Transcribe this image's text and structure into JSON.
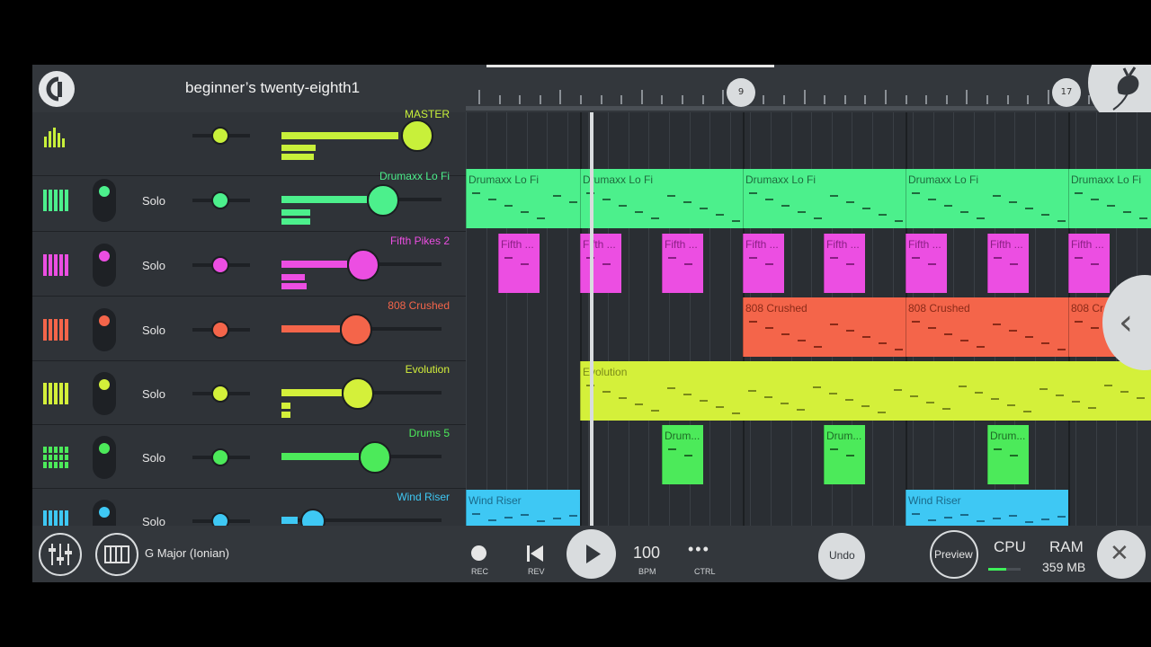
{
  "project": {
    "title": "beginner’s twenty-eighth1"
  },
  "timeline": {
    "markers": [
      "9",
      "17"
    ]
  },
  "tracks": [
    {
      "id": "master",
      "name": "MASTER",
      "color": "#c8f03a",
      "icon": "mixer-bars-icon",
      "solo": ""
    },
    {
      "id": "drumaxx",
      "name": "Drumaxx Lo Fi",
      "color": "#4cf08c",
      "icon": "piano-keys-icon",
      "solo": "Solo"
    },
    {
      "id": "fifth",
      "name": "Fifth Pikes 2",
      "color": "#ec4ee2",
      "icon": "piano-keys-icon",
      "solo": "Solo"
    },
    {
      "id": "808",
      "name": "808 Crushed",
      "color": "#f4654a",
      "icon": "piano-keys-icon",
      "solo": "Solo"
    },
    {
      "id": "evolution",
      "name": "Evolution",
      "color": "#d4f03a",
      "icon": "piano-keys-icon",
      "solo": "Solo"
    },
    {
      "id": "drums5",
      "name": "Drums 5",
      "color": "#4cea5a",
      "icon": "drum-grid-icon",
      "solo": "Solo"
    },
    {
      "id": "wind",
      "name": "Wind Riser",
      "color": "#3ec8f4",
      "icon": "piano-keys-icon",
      "solo": "Solo"
    }
  ],
  "clips": {
    "drumaxx": [
      "Drumaxx Lo Fi",
      "Drumaxx Lo Fi",
      "Drumaxx Lo Fi",
      "Drumaxx Lo Fi",
      "Drumaxx Lo Fi"
    ],
    "fifth": [
      "Fifth ...",
      "Fifth ...",
      "Fifth ...",
      "Fifth ...",
      "Fifth ...",
      "Fifth ...",
      "Fifth ...",
      "Fifth ..."
    ],
    "808": [
      "808 Crushed",
      "808 Crushed",
      "808 Cr"
    ],
    "evolution": [
      "Evolution"
    ],
    "drums5": [
      "Drum...",
      "Drum...",
      "Drum..."
    ],
    "wind": [
      "Wind Riser",
      "Wind Riser"
    ]
  },
  "bottombar": {
    "scale": "G Major (Ionian)",
    "rec": "REC",
    "rev": "REV",
    "bpm_value": "100",
    "bpm_label": "BPM",
    "ctrl_dots": "•••",
    "ctrl_label": "CTRL",
    "undo": "Undo",
    "preview": "Preview",
    "cpu": "CPU",
    "ram": "RAM",
    "ram_value": "359 MB",
    "close": "✕"
  }
}
